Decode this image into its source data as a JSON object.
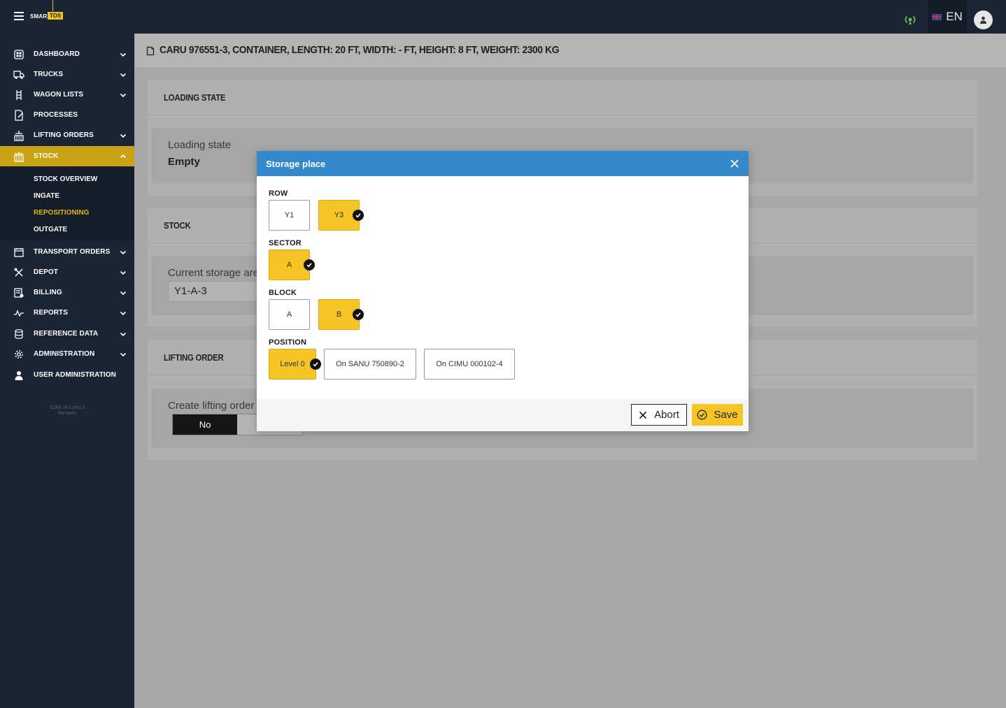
{
  "app": {
    "logo_smart": "SMART",
    "logo_tos": "TOS"
  },
  "topbar": {
    "language": "EN"
  },
  "sidebar": {
    "items": [
      {
        "label": "DASHBOARD",
        "icon": "dashboard-icon",
        "chevron": "down"
      },
      {
        "label": "TRUCKS",
        "icon": "truck-icon",
        "chevron": "down"
      },
      {
        "label": "WAGON LISTS",
        "icon": "wagon-icon",
        "chevron": "down"
      },
      {
        "label": "PROCESSES",
        "icon": "process-icon",
        "chevron": ""
      },
      {
        "label": "LIFTING ORDERS",
        "icon": "crane-icon",
        "chevron": "down"
      },
      {
        "label": "STOCK",
        "icon": "stock-icon",
        "chevron": "up",
        "active": true
      },
      {
        "label": "TRANSPORT ORDERS",
        "icon": "calendar-icon",
        "chevron": "down"
      },
      {
        "label": "DEPOT",
        "icon": "tools-icon",
        "chevron": "down"
      },
      {
        "label": "BILLING",
        "icon": "billing-icon",
        "chevron": "down"
      },
      {
        "label": "REPORTS",
        "icon": "reports-icon",
        "chevron": "down"
      },
      {
        "label": "REFERENCE DATA",
        "icon": "database-icon",
        "chevron": "down"
      },
      {
        "label": "ADMINISTRATION",
        "icon": "gear-icon",
        "chevron": "down"
      },
      {
        "label": "USER ADMINISTRATION",
        "icon": "user-icon",
        "chevron": ""
      }
    ],
    "stock_sub": [
      {
        "label": "STOCK OVERVIEW"
      },
      {
        "label": "INGATE"
      },
      {
        "label": "REPOSITIONING",
        "active": true
      },
      {
        "label": "OUTGATE"
      }
    ],
    "version_line1": "CORE v0.0.1062.0",
    "version_line2": "RM demo"
  },
  "page": {
    "title": "CARU 976551-3, CONTAINER, LENGTH: 20 FT, WIDTH: - FT, HEIGHT: 8 FT, WEIGHT: 2300 KG"
  },
  "cards": {
    "loading": {
      "title": "LOADING STATE",
      "label": "Loading state",
      "value": "Empty"
    },
    "stock": {
      "title": "STOCK",
      "label": "Current storage area",
      "value": "Y1-A-3"
    },
    "lifting": {
      "title": "LIFTING ORDER",
      "label": "Create lifting order",
      "no_label": "No"
    }
  },
  "modal": {
    "title": "Storage place",
    "row_label": "ROW",
    "rows": [
      {
        "label": "Y1",
        "selected": false
      },
      {
        "label": "Y3",
        "selected": true
      }
    ],
    "sector_label": "SECTOR",
    "sectors": [
      {
        "label": "A",
        "selected": true
      }
    ],
    "block_label": "BLOCK",
    "blocks": [
      {
        "label": "A",
        "selected": false
      },
      {
        "label": "B",
        "selected": true
      }
    ],
    "position_label": "POSITION",
    "positions": [
      {
        "label": "Level 0",
        "selected": true
      },
      {
        "label": "On SANU 750890-2",
        "selected": false
      },
      {
        "label": "On CIMU 000102-4",
        "selected": false
      }
    ],
    "abort_label": "Abort",
    "save_label": "Save"
  },
  "colors": {
    "topbar": "#1c2535",
    "accent_yellow": "#f4c524",
    "modal_header_blue": "#3588c9",
    "status_green": "#6cc04a"
  }
}
